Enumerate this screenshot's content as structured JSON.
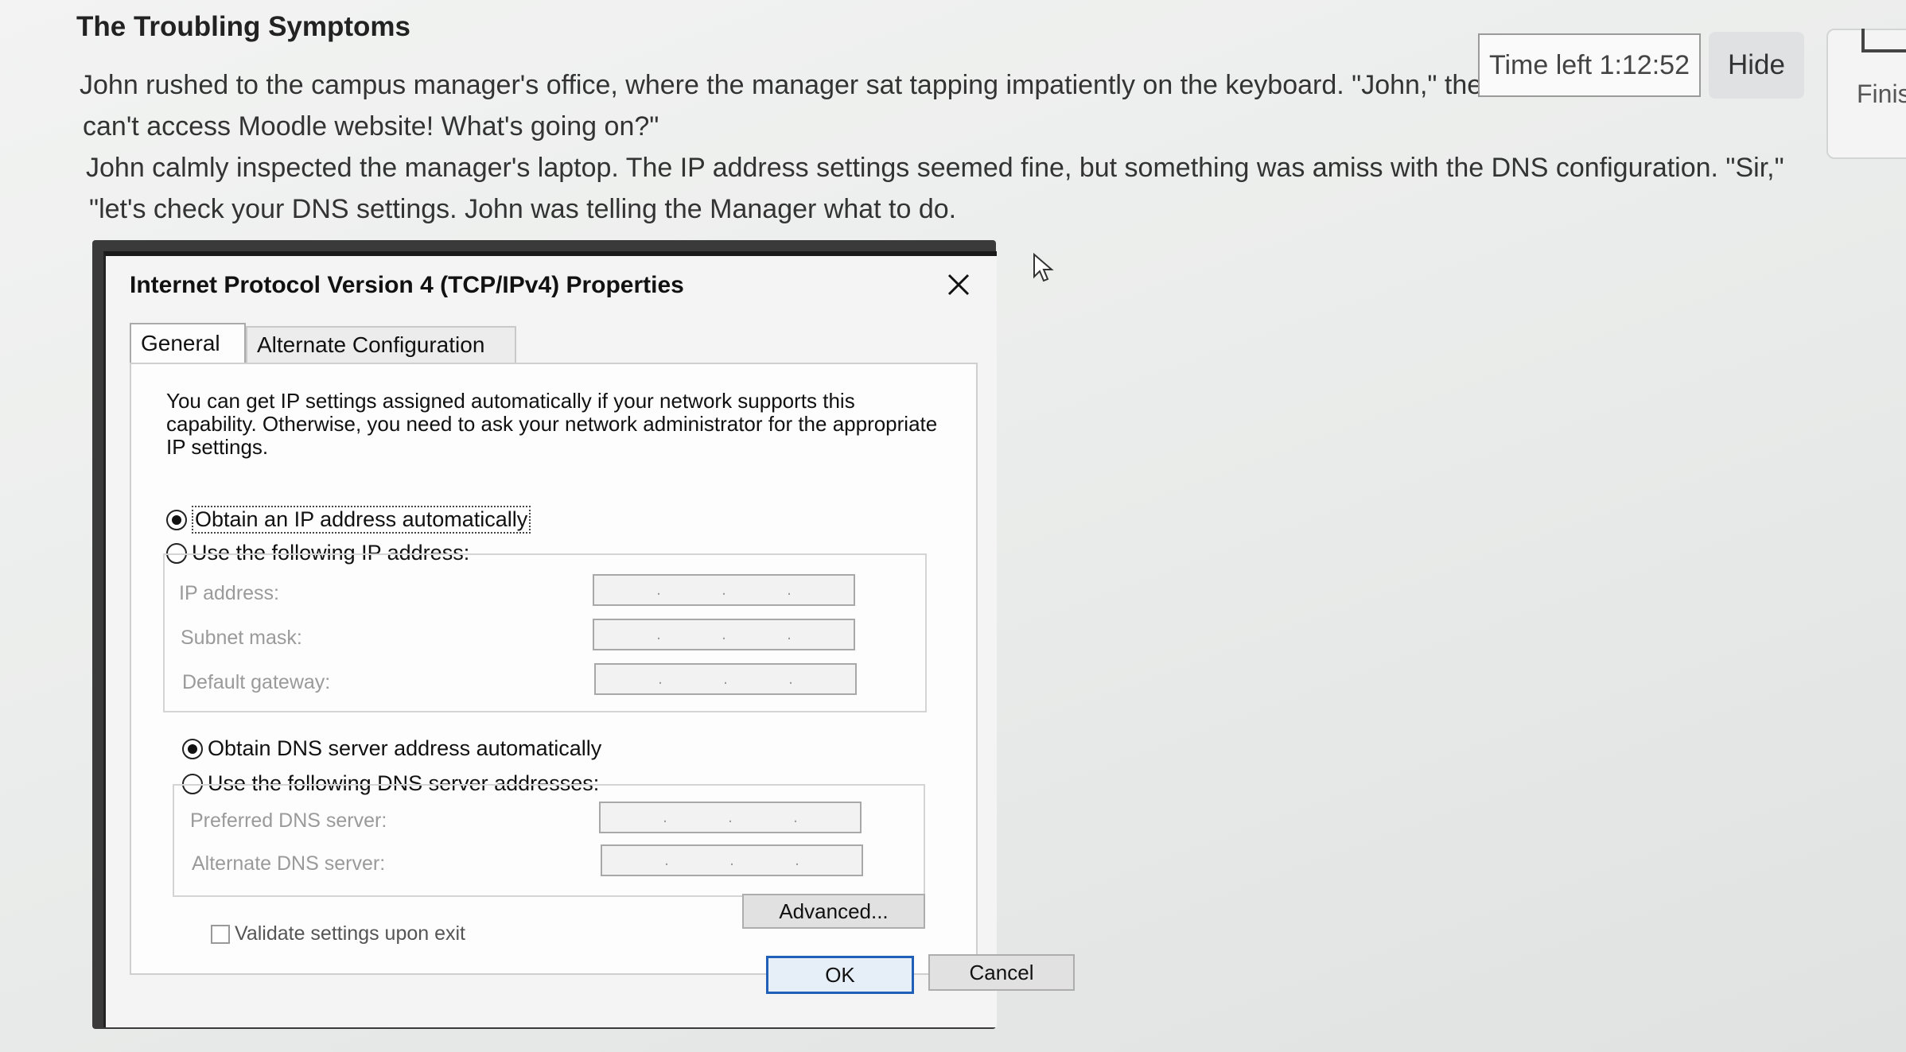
{
  "quiz": {
    "heading": "The Troubling Symptoms",
    "paragraph_lines": [
      "John rushed to the campus manager's office, where the manager sat tapping impatiently on the keyboard. \"John,\" the",
      "can't access Moodle website! What's going on?\"",
      "John calmly inspected the manager's laptop. The IP address settings seemed fine, but something was amiss with the DNS configuration. \"Sir,\"",
      "\"let's check your DNS settings. John was telling the Manager what to do."
    ]
  },
  "timer": {
    "text": "Time left 1:12:52",
    "hide_label": "Hide"
  },
  "sidebar": {
    "finish_label": "Finis"
  },
  "dialog": {
    "title": "Internet Protocol Version 4 (TCP/IPv4) Properties",
    "tabs": [
      {
        "label": "General",
        "active": true
      },
      {
        "label": "Alternate Configuration",
        "active": false
      }
    ],
    "intro": "You can get IP settings assigned automatically if your network supports this capability. Otherwise, you need to ask your network administrator for the appropriate IP settings.",
    "ip_mode": {
      "auto_label": "Obtain an IP address automatically",
      "manual_label": "Use the following IP address:",
      "selected": "auto"
    },
    "ip_fields": [
      {
        "label": "IP address:",
        "value": ""
      },
      {
        "label": "Subnet mask:",
        "value": ""
      },
      {
        "label": "Default gateway:",
        "value": ""
      }
    ],
    "dns_mode": {
      "auto_label": "Obtain DNS server address automatically",
      "manual_label": "Use the following DNS server addresses:",
      "selected": "auto"
    },
    "dns_fields": [
      {
        "label": "Preferred DNS server:",
        "value": ""
      },
      {
        "label": "Alternate DNS server:",
        "value": ""
      }
    ],
    "validate_label": "Validate settings upon exit",
    "validate_checked": false,
    "advanced_label": "Advanced...",
    "ok_label": "OK",
    "cancel_label": "Cancel"
  }
}
